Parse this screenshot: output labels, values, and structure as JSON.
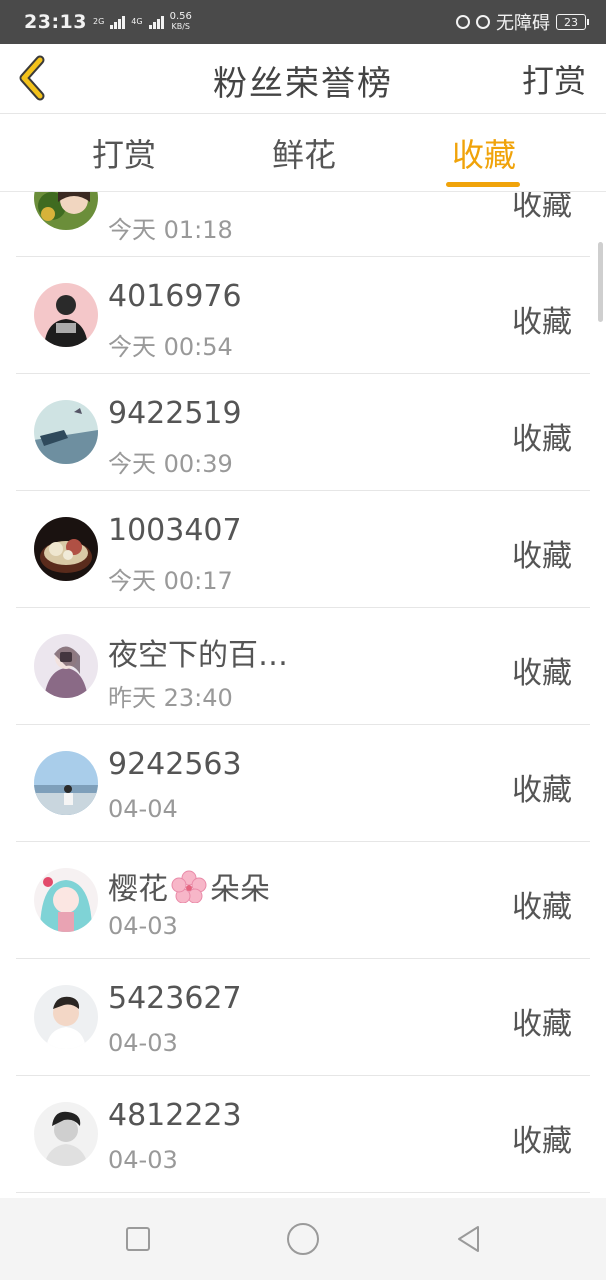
{
  "status_bar": {
    "time": "23:13",
    "net1": "2G",
    "net2": "4G",
    "speed_value": "0.56",
    "speed_unit": "KB/S",
    "accessibility": "无障碍",
    "battery": "23"
  },
  "header": {
    "title": "粉丝荣誉榜",
    "action": "打赏"
  },
  "tabs": [
    {
      "label": "打赏",
      "active": false
    },
    {
      "label": "鲜花",
      "active": false
    },
    {
      "label": "收藏",
      "active": true
    }
  ],
  "colors": {
    "accent": "#f0a30a",
    "text": "#555555",
    "subtext": "#999999",
    "statusbar": "#4a4a4a"
  },
  "rows": [
    {
      "name": "",
      "time": "今天 01:18",
      "action": "收藏",
      "avatar": "anime-girl-avatar"
    },
    {
      "name": "4016976",
      "time": "今天 00:54",
      "action": "收藏",
      "avatar": "person-black-shirt-avatar"
    },
    {
      "name": "9422519",
      "time": "今天 00:39",
      "action": "收藏",
      "avatar": "painting-landscape-avatar"
    },
    {
      "name": "1003407",
      "time": "今天 00:17",
      "action": "收藏",
      "avatar": "food-bowl-avatar"
    },
    {
      "name": "夜空下的百…",
      "time": "昨天 23:40",
      "action": "收藏",
      "avatar": "girl-selfie-avatar"
    },
    {
      "name": "9242563",
      "time": "04-04",
      "action": "收藏",
      "avatar": "beach-person-avatar"
    },
    {
      "name": "樱花",
      "name_suffix": "朵朵",
      "time": "04-03",
      "action": "收藏",
      "avatar": "anime-character-avatar",
      "emoji": "cherry-blossom-icon"
    },
    {
      "name": "5423627",
      "time": "04-03",
      "action": "收藏",
      "avatar": "young-man-avatar"
    },
    {
      "name": "4812223",
      "time": "04-03",
      "action": "收藏",
      "avatar": "man-bw-avatar"
    }
  ]
}
